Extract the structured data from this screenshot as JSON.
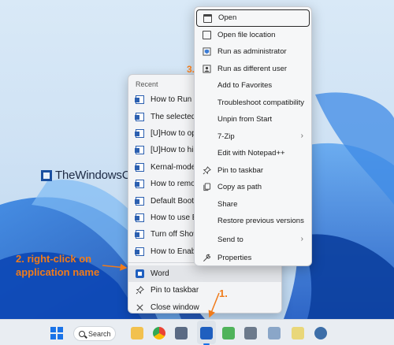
{
  "watermark": {
    "text": "TheWindowsClub"
  },
  "annotations": {
    "step1": "1.",
    "step2": "2. right-click on application name",
    "step3": "3."
  },
  "jump_list": {
    "section_title": "Recent",
    "recent_items": [
      {
        "label": "How to Run a",
        "icon": "word-document-icon"
      },
      {
        "label": "The selected c",
        "icon": "word-document-icon"
      },
      {
        "label": "[U]How to op",
        "icon": "word-document-icon"
      },
      {
        "label": "[U]How to hic",
        "icon": "word-document-icon"
      },
      {
        "label": "Kernal-mode",
        "icon": "word-document-icon"
      },
      {
        "label": "How to remov",
        "icon": "word-document-icon"
      },
      {
        "label": "Default Boot E",
        "icon": "word-document-icon"
      },
      {
        "label": "How to use Er",
        "icon": "word-document-icon"
      },
      {
        "label": "Turn off Show",
        "icon": "word-document-icon"
      },
      {
        "label": "How to Enabl",
        "icon": "word-document-icon"
      }
    ],
    "actions": [
      {
        "label": "Word",
        "icon": "word-app-icon"
      },
      {
        "label": "Pin to taskbar",
        "icon": "pin-icon"
      },
      {
        "label": "Close window",
        "icon": "close-icon"
      }
    ]
  },
  "context_menu": {
    "items": [
      {
        "label": "Open",
        "icon": "open-window-icon"
      },
      {
        "label": "Open file location",
        "icon": "folder-location-icon"
      },
      {
        "label": "Run as administrator",
        "icon": "shield-icon"
      },
      {
        "label": "Run as different user",
        "icon": "user-run-icon"
      },
      {
        "label": "Add to Favorites",
        "icon": ""
      },
      {
        "label": "Troubleshoot compatibility",
        "icon": ""
      },
      {
        "label": "Unpin from Start",
        "icon": ""
      },
      {
        "label": "7-Zip",
        "icon": "",
        "submenu": true
      },
      {
        "label": "Edit with Notepad++",
        "icon": ""
      },
      {
        "label": "Pin to taskbar",
        "icon": "pin-icon"
      },
      {
        "label": "Copy as path",
        "icon": "copy-icon"
      },
      {
        "label": "Share",
        "icon": ""
      },
      {
        "label": "Restore previous versions",
        "icon": ""
      },
      {
        "label": "Send to",
        "icon": "",
        "submenu": true
      },
      {
        "label": "Properties",
        "icon": "wrench-icon"
      }
    ],
    "submenu_glyph": "›"
  },
  "taskbar": {
    "search_label": "Search",
    "accent_color": "#1a73e8"
  }
}
